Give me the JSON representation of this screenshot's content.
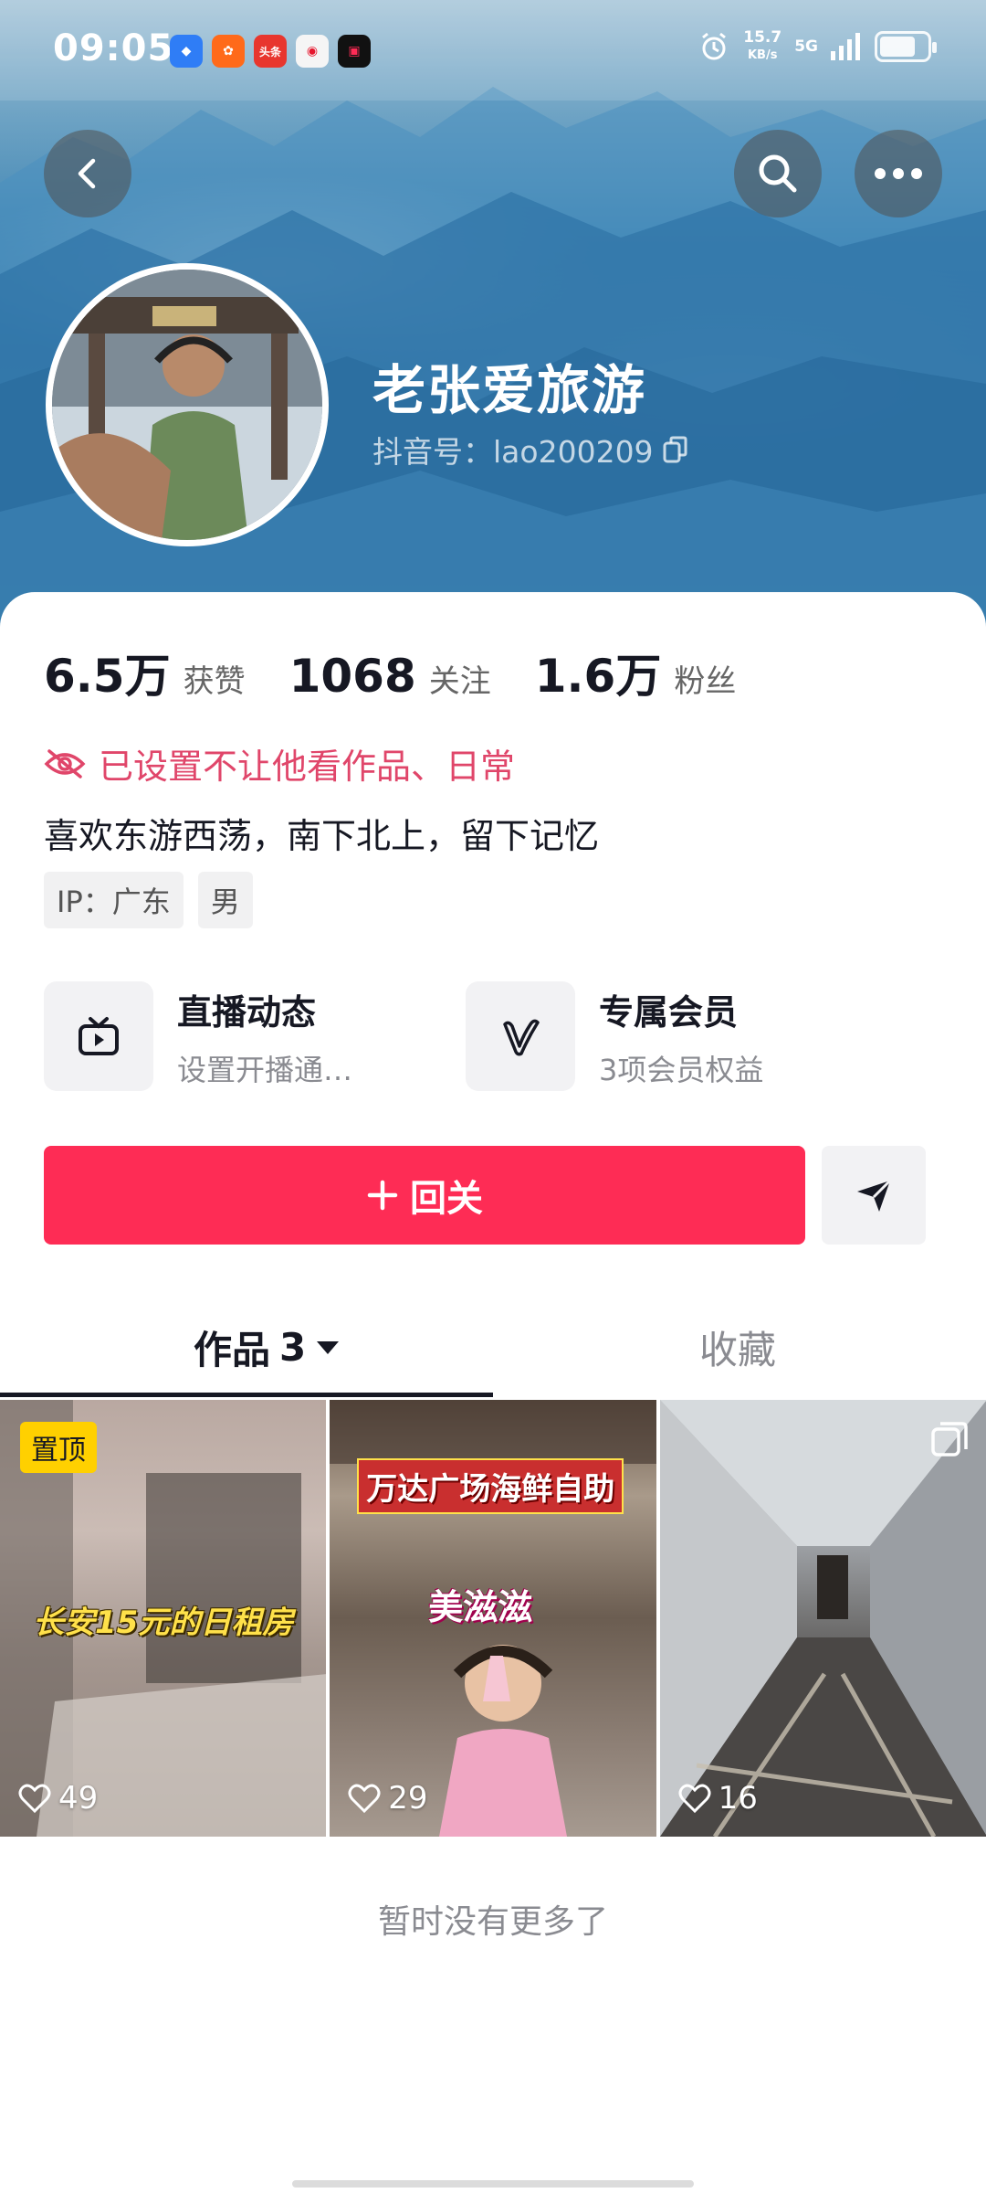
{
  "status_bar": {
    "time": "09:05",
    "app_icons": [
      "app-icon-blue",
      "app-icon-orange",
      "toutiao-icon",
      "weibo-icon",
      "video-app-icon"
    ],
    "toutiao_label": "头条",
    "net_speed_value": "15.7",
    "net_speed_unit": "KB/s",
    "network": "5G",
    "battery_level": 0.75
  },
  "header": {
    "back_icon": "chevron-left-icon",
    "search_icon": "search-icon",
    "more_icon": "more-dots-icon",
    "nickname": "老张爱旅游",
    "douyin_id": "抖音号：lao200209"
  },
  "stats": {
    "likes_count": "6.5万",
    "likes_label": "获赞",
    "following_count": "1068",
    "following_label": "关注",
    "followers_count": "1.6万",
    "followers_label": "粉丝"
  },
  "privacy_notice": "已设置不让他看作品、日常",
  "bio": "喜欢东游西荡，南下北上，留下记忆",
  "tags": [
    "IP：广东",
    "男"
  ],
  "features": [
    {
      "title": "直播动态",
      "subtitle": "设置开播通…",
      "icon": "tv-icon"
    },
    {
      "title": "专属会员",
      "subtitle": "3项会员权益",
      "icon": "v-badge-icon"
    }
  ],
  "actions": {
    "follow_back_label": "回关",
    "message_icon": "send-icon"
  },
  "tabs": {
    "works_label": "作品",
    "works_count": "3",
    "favorites_label": "收藏"
  },
  "videos": [
    {
      "pinned_label": "置顶",
      "caption": "长安15元的日租房",
      "likes": "49"
    },
    {
      "caption_top": "万达广场海鲜自助",
      "caption_mid": "美滋滋",
      "likes": "29"
    },
    {
      "likes": "16"
    }
  ],
  "footer": {
    "no_more": "暂时没有更多了"
  },
  "colors": {
    "accent": "#fe2c55",
    "privacy": "#e0466a",
    "pin": "#ffd000"
  }
}
